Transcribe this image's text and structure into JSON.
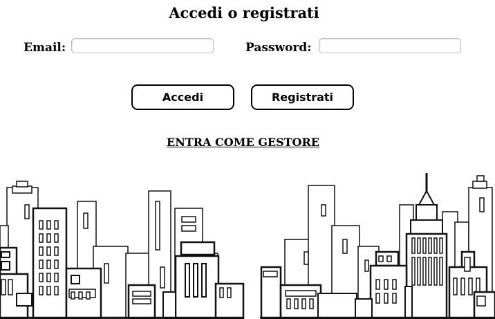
{
  "page": {
    "title": "Accedi o registrati"
  },
  "login_form": {
    "email_label": "Email:",
    "email_value": "",
    "password_label": "Password:",
    "password_value": ""
  },
  "actions": {
    "login_label": "Accedi",
    "register_label": "Registrati",
    "manager_link": "ENTRA COME GESTORE"
  },
  "illustration": {
    "name": "city-skyline-illustration"
  }
}
